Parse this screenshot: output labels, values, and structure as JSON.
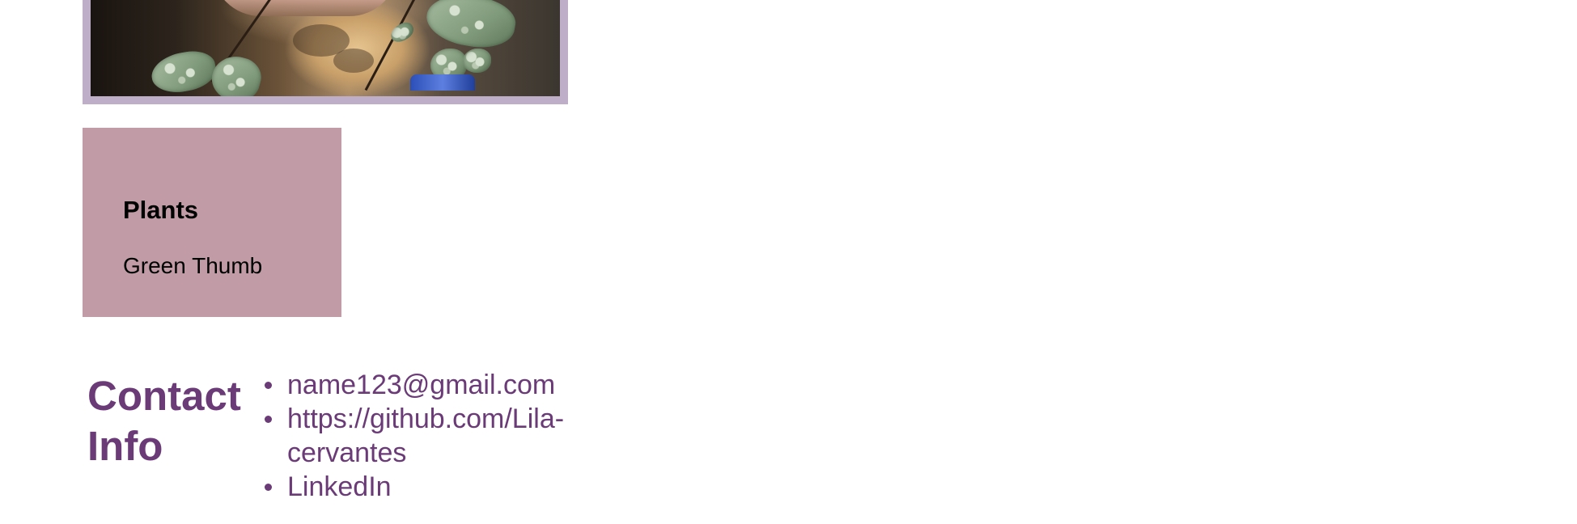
{
  "photo": {
    "alt_description": "",
    "frame_color": "#bfaec7"
  },
  "interest_card": {
    "title": "Plants",
    "subtitle": "Green Thumb",
    "background_color": "#c19ca6"
  },
  "contact": {
    "heading": "Contact Info",
    "accent_color": "#6b3b78",
    "items": [
      {
        "label": "name123@gmail.com"
      },
      {
        "label": "https://github.com/Lila-cervantes"
      },
      {
        "label": "LinkedIn"
      }
    ]
  }
}
